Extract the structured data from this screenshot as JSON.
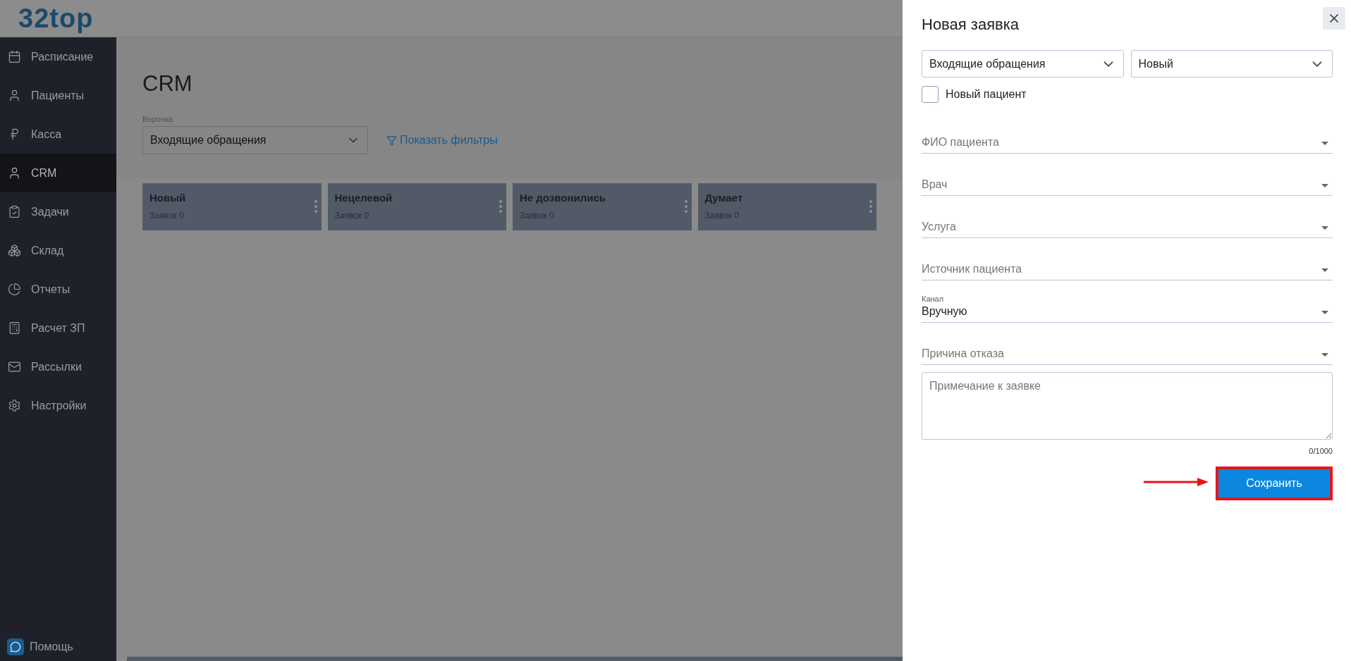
{
  "logo": "32top",
  "sidebar": {
    "items": [
      {
        "label": "Расписание",
        "selected": false
      },
      {
        "label": "Пациенты",
        "selected": false
      },
      {
        "label": "Касса",
        "selected": false
      },
      {
        "label": "CRM",
        "selected": true
      },
      {
        "label": "Задачи",
        "selected": false
      },
      {
        "label": "Склад",
        "selected": false
      },
      {
        "label": "Отчеты",
        "selected": false
      },
      {
        "label": "Расчет ЗП",
        "selected": false
      },
      {
        "label": "Рассылки",
        "selected": false
      },
      {
        "label": "Настройки",
        "selected": false
      }
    ],
    "help": "Помощь"
  },
  "page": {
    "title": "CRM",
    "funnel": {
      "label": "Воронка",
      "value": "Входящие обращения"
    },
    "filters_link": "Показать фильтры",
    "columns": [
      {
        "name": "Новый",
        "count": "Заявок 0"
      },
      {
        "name": "Нецелевой",
        "count": "Заявок 0"
      },
      {
        "name": "Не дозвонились",
        "count": "Заявок 0"
      },
      {
        "name": "Думает",
        "count": "Заявок 0"
      }
    ]
  },
  "panel": {
    "title": "Новая заявка",
    "selects": [
      "Входящие обращения",
      "Новый"
    ],
    "new_patient": {
      "label": "Новый пациент",
      "checked": false
    },
    "fields": [
      {
        "placeholder": "ФИО пациента"
      },
      {
        "placeholder": "Врач"
      },
      {
        "placeholder": "Услуга"
      },
      {
        "placeholder": "Источник пациента"
      },
      {
        "label": "Канал",
        "value": "Вручную"
      },
      {
        "placeholder": "Причина отказа"
      }
    ],
    "note": {
      "placeholder": "Примечание к заявке",
      "counter": "0/1000"
    },
    "save": "Сохранить"
  }
}
